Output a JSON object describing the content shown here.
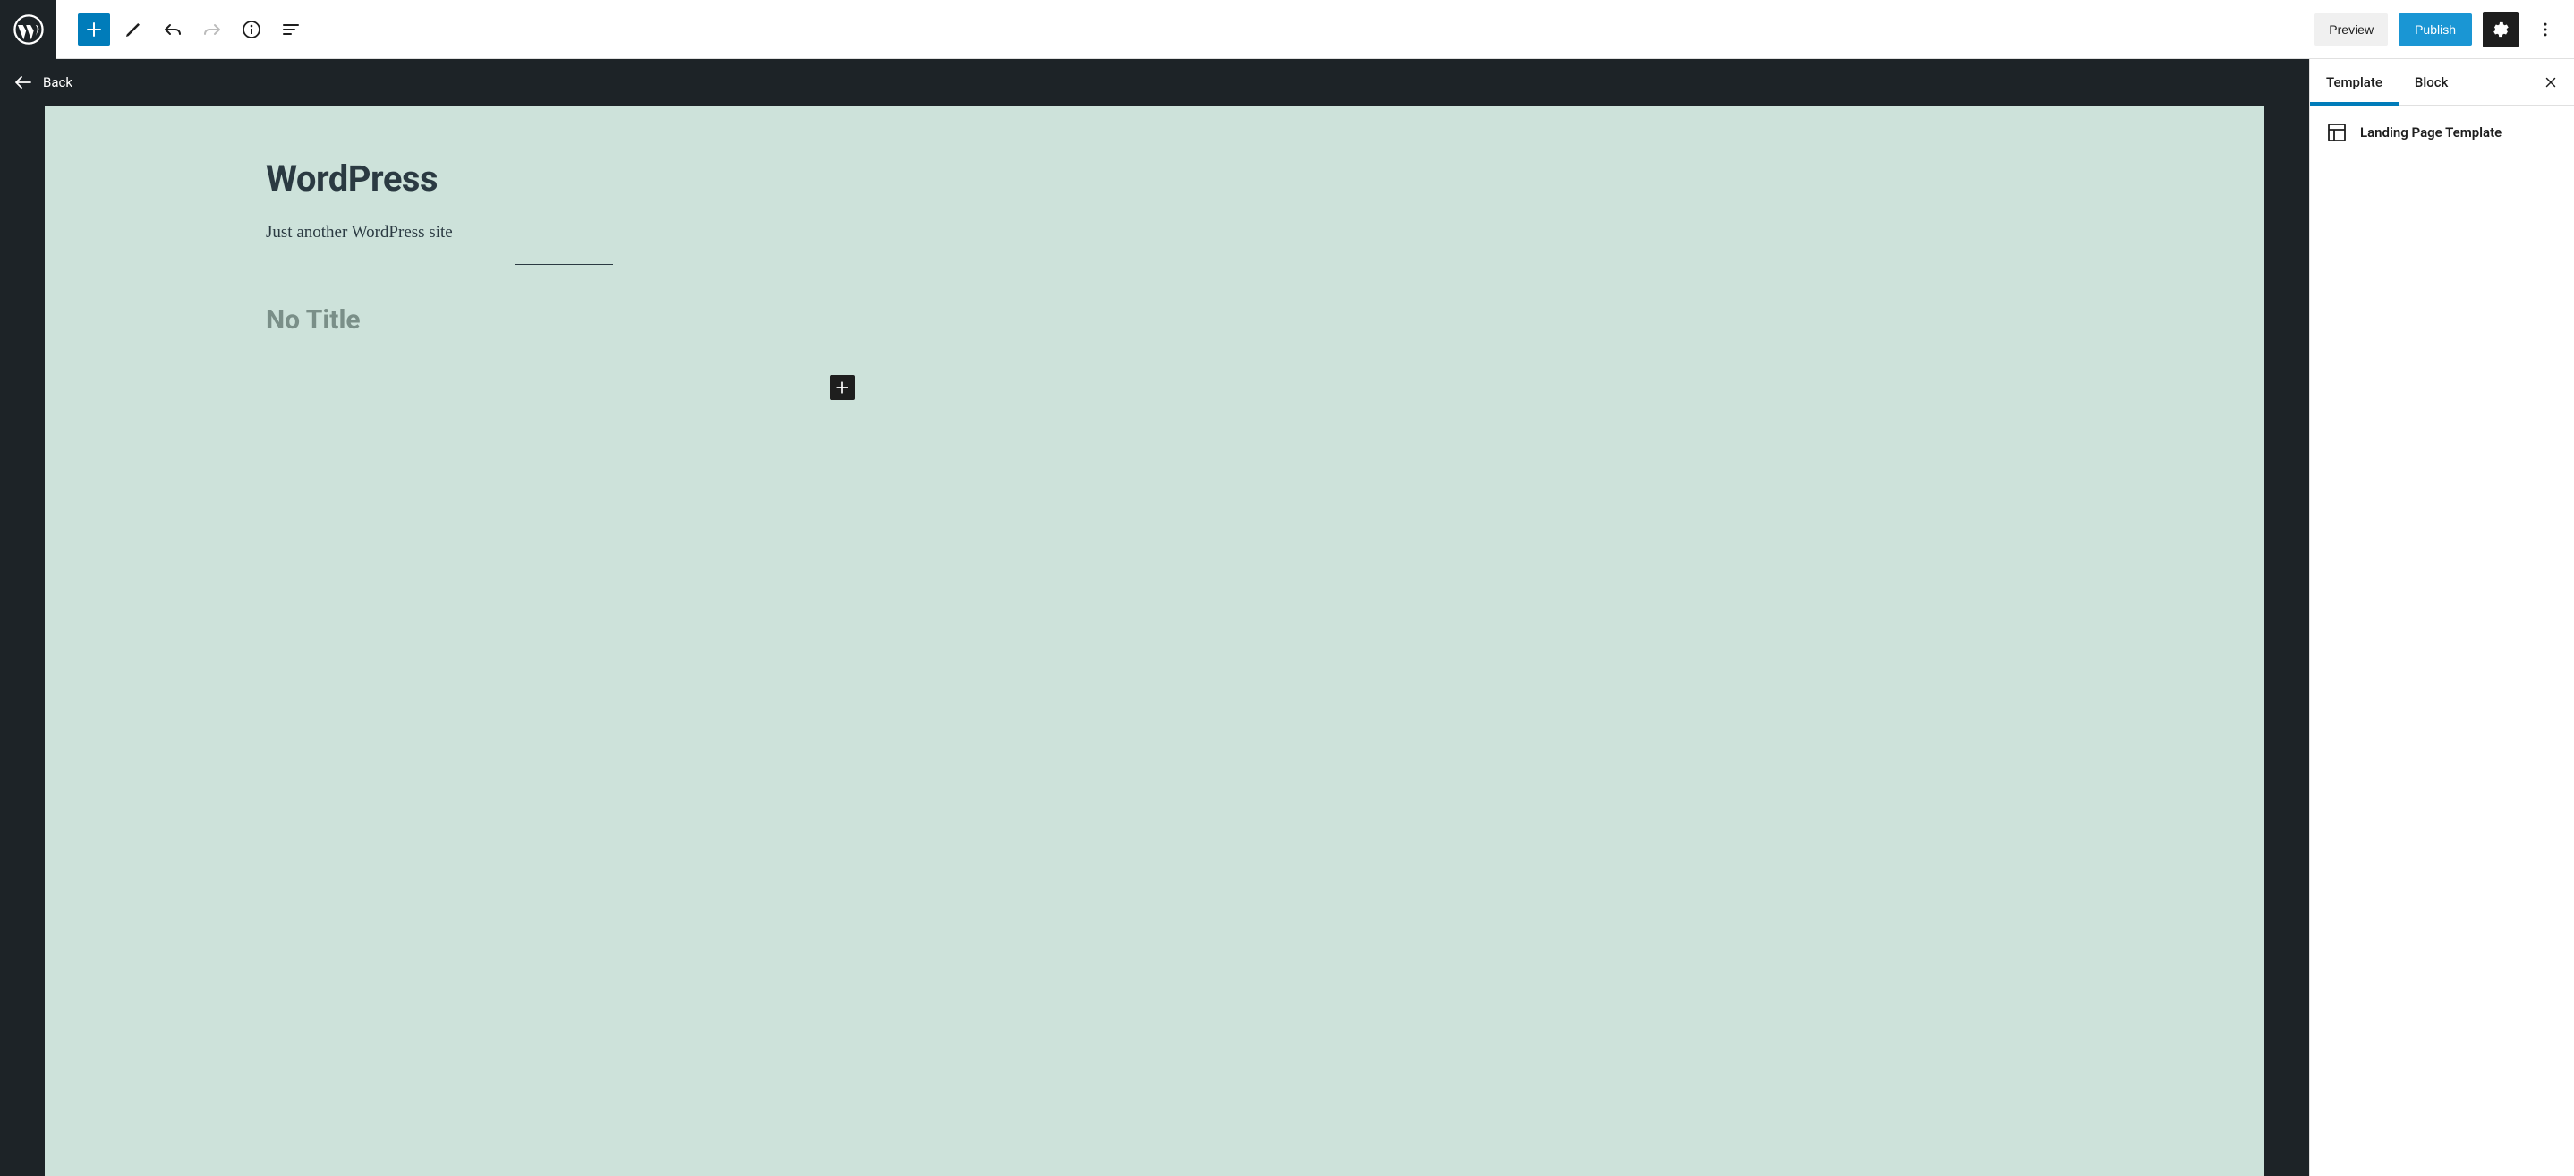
{
  "toolbar": {
    "preview_label": "Preview",
    "publish_label": "Publish"
  },
  "back_label": "Back",
  "canvas": {
    "site_title": "WordPress",
    "tagline": "Just another WordPress site",
    "post_title": "No Title"
  },
  "sidebar": {
    "tabs": {
      "template": "Template",
      "block": "Block"
    },
    "template_name": "Landing Page Template"
  }
}
